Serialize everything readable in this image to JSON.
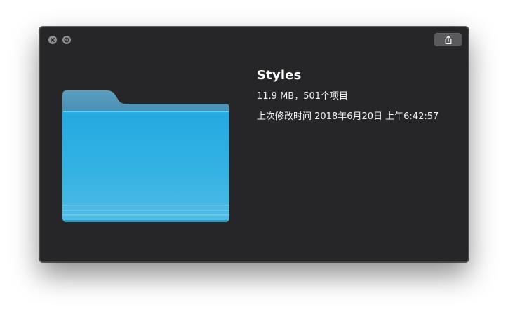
{
  "window": {
    "controls": {
      "close_icon": "close-icon",
      "fullscreen_icon": "fullscreen-icon"
    },
    "toolbar": {
      "share_icon": "share-icon"
    }
  },
  "file": {
    "icon": "folder-icon",
    "name": "Styles",
    "size_and_items": "11.9 MB，501个项目",
    "modified": "上次修改时间 2018年6月20日 上午6:42:57"
  },
  "colors": {
    "window_background": "#262628",
    "folder_blue": "#2aa7dc",
    "control_gray": "#8e8e90"
  }
}
